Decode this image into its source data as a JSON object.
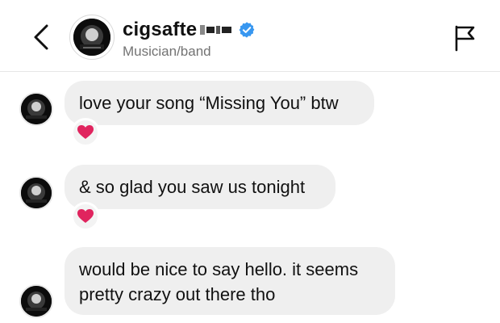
{
  "header": {
    "username": "cigsafte",
    "subtitle": "Musician/band",
    "verified": true
  },
  "messages": [
    {
      "text": "love your song “Missing You” btw",
      "reaction": "red-heart"
    },
    {
      "text": "& so glad you saw us tonight",
      "reaction": "red-heart"
    },
    {
      "text": "would be nice to say hello. it seems pretty crazy out there tho",
      "reaction": null
    }
  ],
  "colors": {
    "verified_blue": "#3897f0",
    "bubble_bg": "#efefef",
    "heart_red": "#e0245e"
  }
}
